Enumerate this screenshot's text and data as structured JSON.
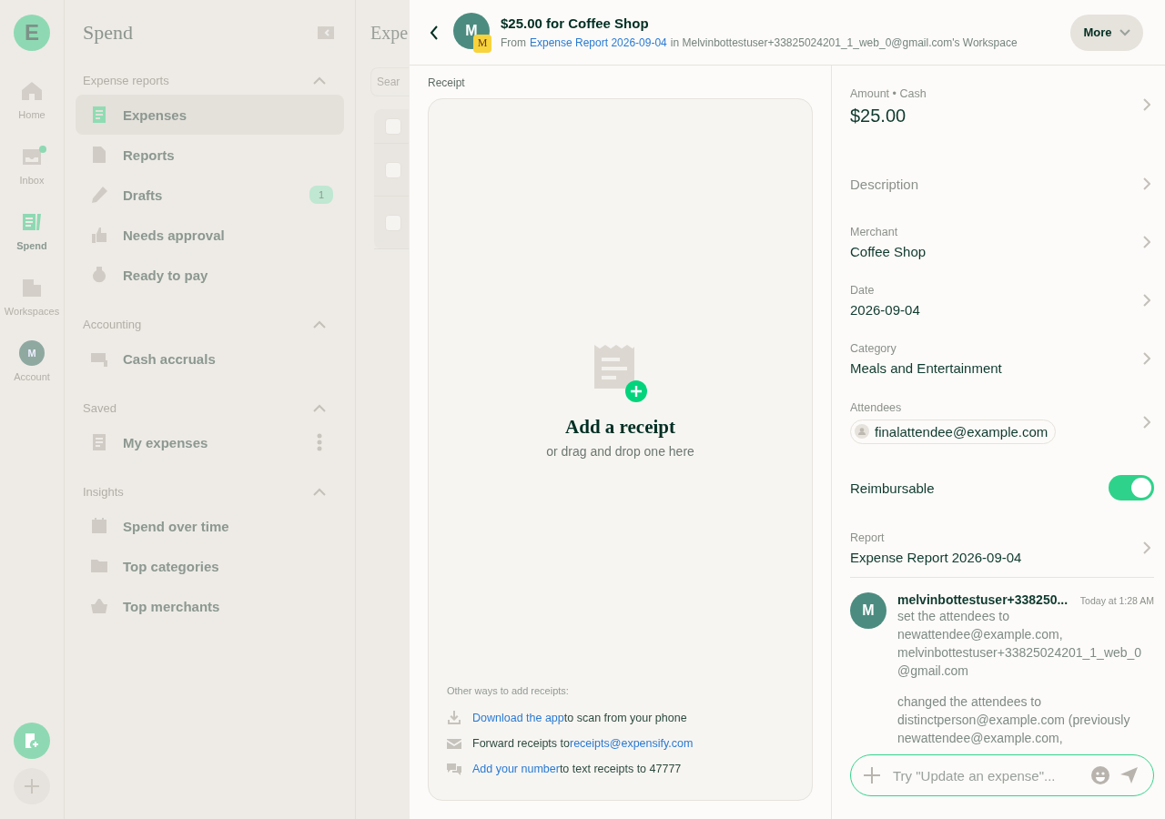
{
  "rail": {
    "logo": "E",
    "items": [
      {
        "label": "Home",
        "selected": false
      },
      {
        "label": "Inbox",
        "selected": false,
        "dot": true
      },
      {
        "label": "Spend",
        "selected": true
      },
      {
        "label": "Workspaces",
        "selected": false
      },
      {
        "label": "Account",
        "selected": false,
        "avatar": "M"
      }
    ]
  },
  "sidebar": {
    "title": "Spend",
    "sections": [
      {
        "title": "Expense reports",
        "expanded": true,
        "items": [
          {
            "label": "Expenses",
            "selected": true
          },
          {
            "label": "Reports",
            "selected": false
          },
          {
            "label": "Drafts",
            "selected": false,
            "badge": "1"
          },
          {
            "label": "Needs approval",
            "selected": false
          },
          {
            "label": "Ready to pay",
            "selected": false
          }
        ]
      },
      {
        "title": "Accounting",
        "expanded": true,
        "items": [
          {
            "label": "Cash accruals",
            "selected": false
          }
        ]
      },
      {
        "title": "Saved",
        "expanded": true,
        "items": [
          {
            "label": "My expenses",
            "selected": false,
            "menu": true
          }
        ]
      },
      {
        "title": "Insights",
        "expanded": true,
        "items": [
          {
            "label": "Spend over time",
            "selected": false
          },
          {
            "label": "Top categories",
            "selected": false
          },
          {
            "label": "Top merchants",
            "selected": false
          }
        ]
      }
    ]
  },
  "main": {
    "title": "Expe",
    "search": {
      "placeholder": "Sear"
    },
    "table": {
      "all_checked": false,
      "rows": [
        {
          "checked": false
        },
        {
          "checked": false
        }
      ]
    }
  },
  "panel": {
    "header": {
      "avatar": "M",
      "badge": "M",
      "title": "$25.00 for Coffee Shop",
      "from": "From",
      "report_link": "Expense Report 2026-09-04",
      "workspace": "in Melvinbottestuser+33825024201_1_web_0@gmail.com's Workspace",
      "more": "More"
    },
    "receipt": {
      "label": "Receipt",
      "heading": "Add a receipt",
      "subheading": "or drag and drop one here",
      "other_title": "Other ways to add receipts:",
      "ways": [
        {
          "link": "Download the app",
          "after": "to scan from your phone"
        },
        {
          "before": "Forward receipts to",
          "link": "receipts@expensify.com"
        },
        {
          "link": "Add your number",
          "after": "to text receipts to 47777"
        }
      ]
    },
    "details": [
      {
        "kind": "amount",
        "label": "Amount • Cash",
        "value": "$25.00"
      },
      {
        "kind": "field",
        "label": "Description"
      },
      {
        "kind": "field",
        "label": "Merchant",
        "value": "Coffee Shop"
      },
      {
        "kind": "field",
        "label": "Date",
        "value": "2026-09-04"
      },
      {
        "kind": "field",
        "label": "Category",
        "value": "Meals and Entertainment"
      },
      {
        "kind": "attendees",
        "label": "Attendees",
        "value": "finalattendee@example.com"
      },
      {
        "kind": "toggle",
        "label": "Reimbursable",
        "on": true
      },
      {
        "kind": "field",
        "label": "Report",
        "value": "Expense Report 2026-09-04"
      }
    ],
    "comment": {
      "avatar": "M",
      "author": "melvinbottestuser+338250...",
      "time": "Today at 1:28 AM",
      "messages": [
        "set the attendees to newattendee@example.com, melvinbottestuser+33825024201_1_web_0@gmail.com",
        "changed the attendees to distinctperson@example.com (previously newattendee@example.com,"
      ]
    },
    "composer": {
      "placeholder": "Try \"Update an expense\"..."
    }
  }
}
